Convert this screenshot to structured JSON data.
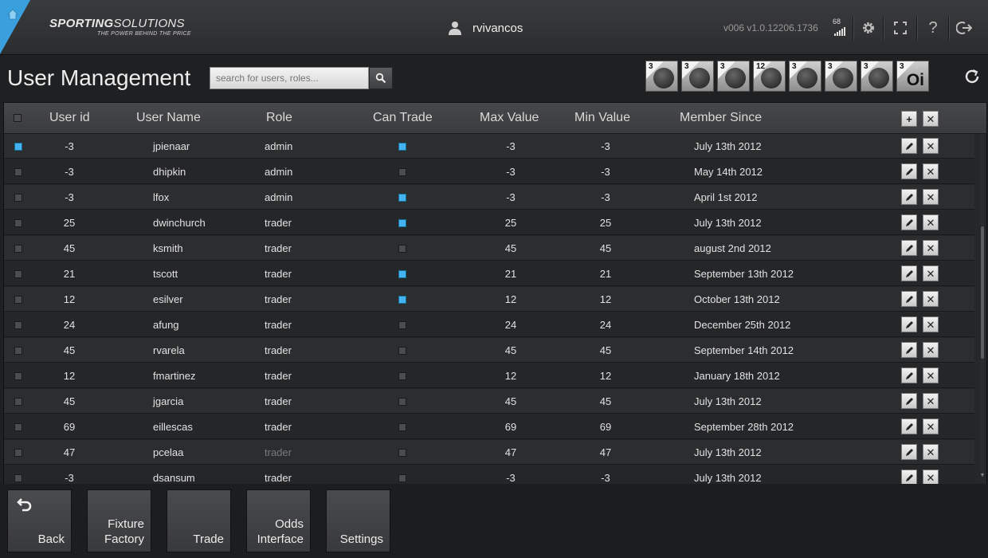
{
  "header": {
    "logo_main": "SPORTING",
    "logo_main2": "SOLUTIONS",
    "logo_tag": "THE POWER BEHIND THE PRICE",
    "username": "rvivancos",
    "version": "v006 v1.0.12206.1736",
    "signal_count": "68",
    "icons": [
      "home-icon",
      "user-icon",
      "signal-icon",
      "gear-icon",
      "fullscreen-icon",
      "help-icon",
      "logout-icon"
    ]
  },
  "page": {
    "title": "User Management",
    "search_placeholder": "search for users, roles..."
  },
  "sport_tabs": [
    {
      "count": "3",
      "sport": "hockey"
    },
    {
      "count": "3",
      "sport": "volleyball"
    },
    {
      "count": "3",
      "sport": "basketball"
    },
    {
      "count": "12",
      "sport": "rugby"
    },
    {
      "count": "3",
      "sport": "target"
    },
    {
      "count": "3",
      "sport": "football"
    },
    {
      "count": "3",
      "sport": "american-football"
    },
    {
      "count": "3",
      "sport": "other",
      "glyph": "Oi"
    }
  ],
  "table": {
    "columns": [
      "User id",
      "User Name",
      "Role",
      "Can Trade",
      "Max Value",
      "Min Value",
      "Member Since"
    ],
    "add_label": "+",
    "delete_label": "✕",
    "rows": [
      {
        "selected": true,
        "user_id": "-3",
        "user_name": "jpienaar",
        "role": "admin",
        "can_trade": true,
        "max": "-3",
        "min": "-3",
        "since": "July 13th 2012"
      },
      {
        "selected": false,
        "user_id": "-3",
        "user_name": "dhipkin",
        "role": "admin",
        "can_trade": false,
        "max": "-3",
        "min": "-3",
        "since": "May 14th 2012"
      },
      {
        "selected": false,
        "user_id": "-3",
        "user_name": "lfox",
        "role": "admin",
        "can_trade": true,
        "max": "-3",
        "min": "-3",
        "since": "April 1st 2012"
      },
      {
        "selected": false,
        "user_id": "25",
        "user_name": "dwinchurch",
        "role": "trader",
        "can_trade": true,
        "max": "25",
        "min": "25",
        "since": "July 13th 2012"
      },
      {
        "selected": false,
        "user_id": "45",
        "user_name": "ksmith",
        "role": "trader",
        "can_trade": false,
        "max": "45",
        "min": "45",
        "since": "august 2nd 2012"
      },
      {
        "selected": false,
        "user_id": "21",
        "user_name": "tscott",
        "role": "trader",
        "can_trade": true,
        "max": "21",
        "min": "21",
        "since": "September 13th 2012"
      },
      {
        "selected": false,
        "user_id": "12",
        "user_name": "esilver",
        "role": "trader",
        "can_trade": true,
        "max": "12",
        "min": "12",
        "since": "October 13th 2012"
      },
      {
        "selected": false,
        "user_id": "24",
        "user_name": "afung",
        "role": "trader",
        "can_trade": false,
        "max": "24",
        "min": "24",
        "since": "December 25th 2012"
      },
      {
        "selected": false,
        "user_id": "45",
        "user_name": "rvarela",
        "role": "trader",
        "can_trade": false,
        "max": "45",
        "min": "45",
        "since": "September 14th 2012"
      },
      {
        "selected": false,
        "user_id": "12",
        "user_name": "fmartinez",
        "role": "trader",
        "can_trade": false,
        "max": "12",
        "min": "12",
        "since": "January 18th 2012"
      },
      {
        "selected": false,
        "user_id": "45",
        "user_name": "jgarcia",
        "role": "trader",
        "can_trade": false,
        "max": "45",
        "min": "45",
        "since": "July 13th 2012"
      },
      {
        "selected": false,
        "user_id": "69",
        "user_name": "eillescas",
        "role": "trader",
        "can_trade": false,
        "max": "69",
        "min": "69",
        "since": "September 28th 2012"
      },
      {
        "selected": false,
        "user_id": "47",
        "user_name": "pcelaa",
        "role": "trader",
        "role_dim": true,
        "can_trade": false,
        "max": "47",
        "min": "47",
        "since": "July 13th 2012"
      },
      {
        "selected": false,
        "user_id": "-3",
        "user_name": "dsansum",
        "role": "trader",
        "can_trade": false,
        "max": "-3",
        "min": "-3",
        "since": "July 13th 2012"
      }
    ]
  },
  "footer": {
    "tiles": [
      {
        "label": "Back",
        "icon": "back-arrow-icon"
      },
      {
        "label": "Fixture Factory"
      },
      {
        "label": "Trade"
      },
      {
        "label": "Odds Interface"
      },
      {
        "label": "Settings"
      }
    ]
  },
  "colors": {
    "accent": "#3aa0dd",
    "checked": "#43b4ef",
    "background": "#1f2022"
  }
}
